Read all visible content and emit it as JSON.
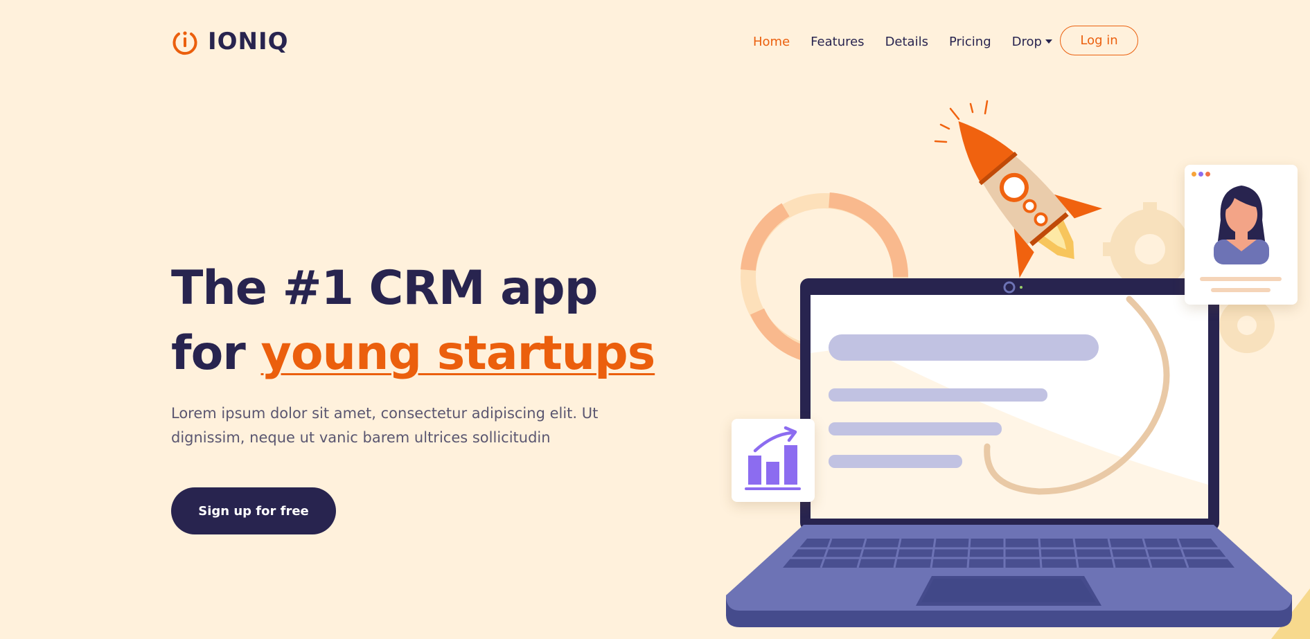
{
  "brand": {
    "name": "IONIQ",
    "logo_icon": "power-icon"
  },
  "nav": {
    "items": [
      {
        "label": "Home",
        "active": true
      },
      {
        "label": "Features"
      },
      {
        "label": "Details"
      },
      {
        "label": "Pricing"
      },
      {
        "label": "Drop",
        "dropdown": true
      }
    ],
    "login_label": "Log in"
  },
  "hero": {
    "title_line1": "The #1 CRM app",
    "title_line2_prefix": "for ",
    "title_highlight": "young startups",
    "subtitle": "Lorem ipsum dolor sit amet, consectetur adipiscing elit. Ut dignissim, neque ut vanic barem ultrices sollicitudin",
    "cta_label": "Sign up for free"
  },
  "colors": {
    "background": "#fff1dc",
    "navy": "#28244f",
    "accent": "#eb5f0d",
    "purple": "#8c6cf0",
    "laptop": "#6d73b5"
  },
  "illustration": {
    "icons": [
      "rocket-icon",
      "laptop-icon",
      "bar-chart-icon",
      "user-avatar-icon",
      "gear-icon",
      "donut-ring-icon"
    ]
  }
}
